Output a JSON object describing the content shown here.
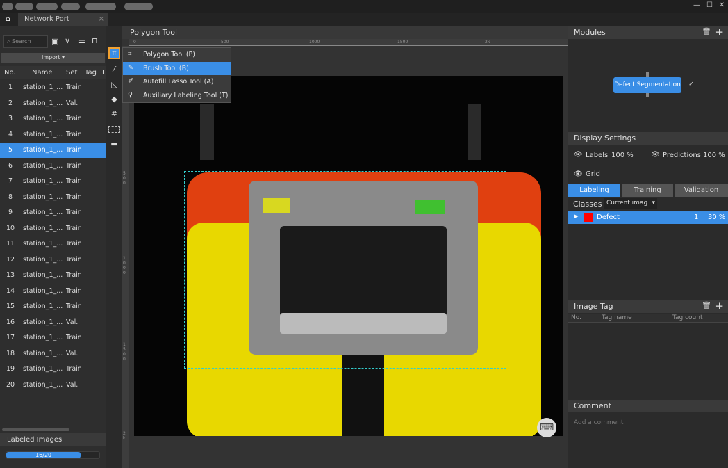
{
  "window": {
    "tab_title": "Network Port",
    "close": "×",
    "controls": [
      "—",
      "☐",
      "✕"
    ]
  },
  "left": {
    "search_placeholder": "Search",
    "import_label": "Import ▾",
    "columns": [
      "No.",
      "Name",
      "Set",
      "Tag",
      "L"
    ],
    "rows": [
      {
        "no": "1",
        "name": "station_1_...",
        "set": "Train"
      },
      {
        "no": "2",
        "name": "station_1_...",
        "set": "Val."
      },
      {
        "no": "3",
        "name": "station_1_...",
        "set": "Train"
      },
      {
        "no": "4",
        "name": "station_1_...",
        "set": "Train"
      },
      {
        "no": "5",
        "name": "station_1_...",
        "set": "Train"
      },
      {
        "no": "6",
        "name": "station_1_...",
        "set": "Train"
      },
      {
        "no": "7",
        "name": "station_1_...",
        "set": "Train"
      },
      {
        "no": "8",
        "name": "station_1_...",
        "set": "Train"
      },
      {
        "no": "9",
        "name": "station_1_...",
        "set": "Train"
      },
      {
        "no": "10",
        "name": "station_1_...",
        "set": "Train"
      },
      {
        "no": "11",
        "name": "station_1_...",
        "set": "Train"
      },
      {
        "no": "12",
        "name": "station_1_...",
        "set": "Train"
      },
      {
        "no": "13",
        "name": "station_1_...",
        "set": "Train"
      },
      {
        "no": "14",
        "name": "station_1_...",
        "set": "Train"
      },
      {
        "no": "15",
        "name": "station_1_...",
        "set": "Train"
      },
      {
        "no": "16",
        "name": "station_1_...",
        "set": "Val."
      },
      {
        "no": "17",
        "name": "station_1_...",
        "set": "Train"
      },
      {
        "no": "18",
        "name": "station_1_...",
        "set": "Val."
      },
      {
        "no": "19",
        "name": "station_1_...",
        "set": "Train"
      },
      {
        "no": "20",
        "name": "station_1_...",
        "set": "Val."
      }
    ],
    "selected_row": 5,
    "labeled_title": "Labeled Images",
    "labeled_text": "16/20",
    "labeled_progress": 0.8
  },
  "canvas": {
    "title": "Polygon Tool",
    "ruler_top": [
      "0",
      "500",
      "1000",
      "1500",
      "2k"
    ],
    "ruler_left": [
      "500",
      "1000",
      "1500",
      "2k"
    ],
    "tool_menu": [
      {
        "label": "Polygon Tool (P)",
        "icon": "polygon-icon"
      },
      {
        "label": "Brush Tool (B)",
        "icon": "brush-icon",
        "selected": true
      },
      {
        "label": "Autofill Lasso Tool (A)",
        "icon": "lasso-icon"
      },
      {
        "label": "Auxiliary Labeling Tool (T)",
        "icon": "auxiliary-icon"
      }
    ]
  },
  "right": {
    "modules_title": "Modules",
    "module_node": "Defect Segmentation",
    "display_title": "Display Settings",
    "labels": "Labels",
    "labels_pct": "100 %",
    "predictions": "Predictions",
    "predictions_pct": "100 %",
    "grid": "Grid",
    "tabs": [
      "Labeling",
      "Training",
      "Validation"
    ],
    "classes_label": "Classes",
    "classes_filter": "Current imag",
    "class": {
      "name": "Defect",
      "count": "1",
      "pct": "30 %",
      "color": "#ff0000"
    },
    "image_tag_title": "Image Tag",
    "tag_cols": [
      "No.",
      "Tag name",
      "Tag count"
    ],
    "comment_title": "Comment",
    "comment_placeholder": "Add a comment"
  },
  "colors": {
    "accent": "#3a8ee6",
    "highlight": "#f0a030"
  }
}
